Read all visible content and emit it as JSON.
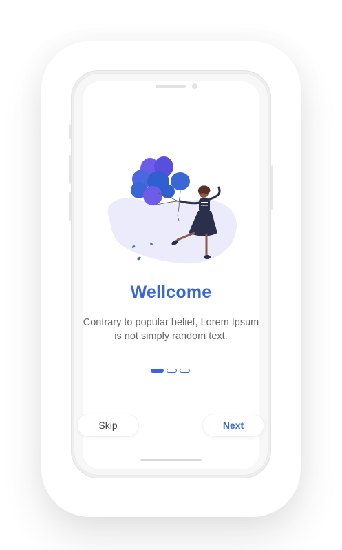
{
  "onboarding": {
    "title": "Wellcome",
    "description": "Contrary to popular belief, Lorem Ipsum is not simply random text.",
    "pagination": {
      "total": 3,
      "current": 1
    },
    "skip_label": "Skip",
    "next_label": "Next"
  },
  "colors": {
    "accent": "#3a66d6",
    "text_secondary": "#666666",
    "balloon_purple": "#6c5ce7",
    "balloon_blue": "#2f5fd0",
    "blob": "#ecebfb"
  },
  "icons": {
    "illustration": "woman-with-balloons-illustration"
  }
}
